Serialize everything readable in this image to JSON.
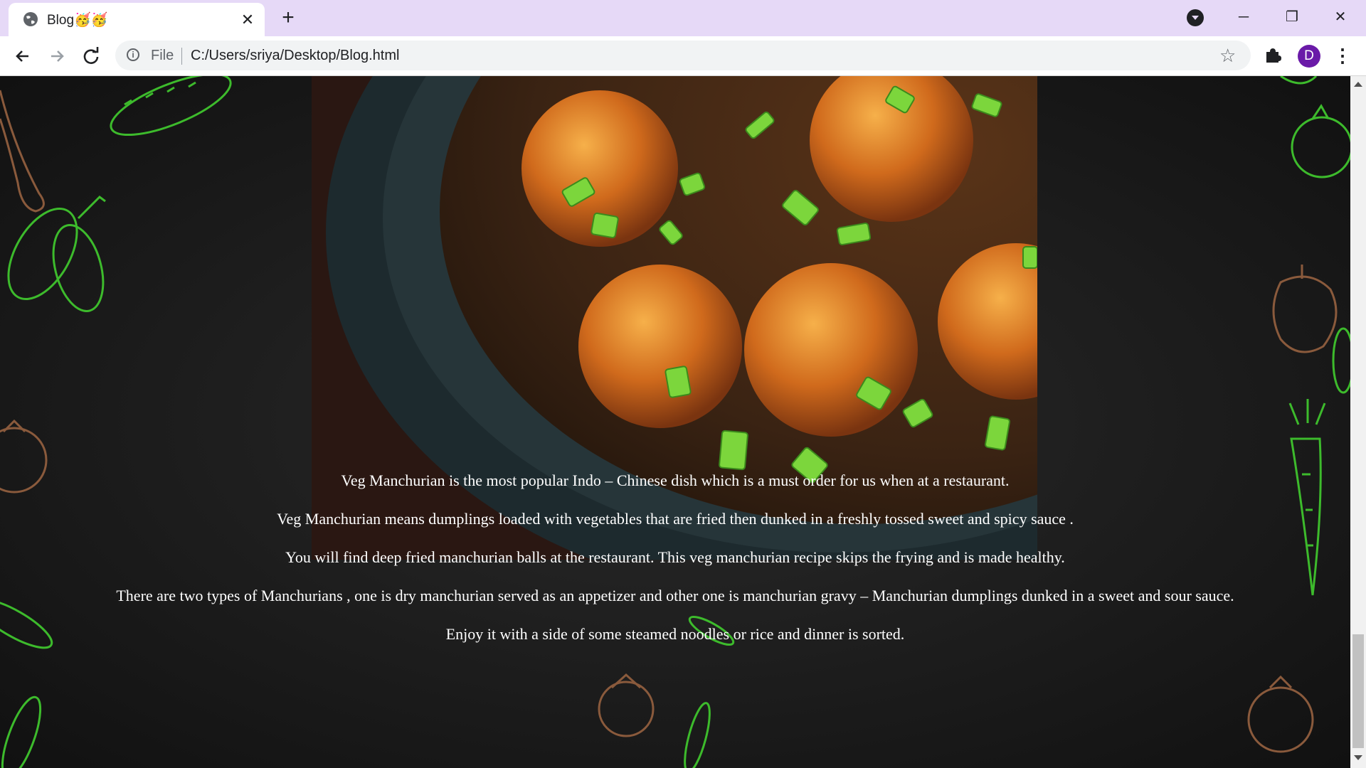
{
  "browser": {
    "tab_title": "Blog🥳🥳",
    "new_tab_symbol": "+",
    "close_symbol": "✕",
    "url_scheme": "File",
    "url": "C:/Users/sriya/Desktop/Blog.html",
    "profile_initial": "D",
    "window_controls": {
      "minimize": "─",
      "restore": "❐",
      "close": "✕"
    },
    "icons": [
      "globe-icon",
      "back-arrow-icon",
      "forward-arrow-icon",
      "reload-icon",
      "info-icon",
      "star-icon",
      "puzzle-icon",
      "more-vert-icon"
    ]
  },
  "content": {
    "image_subject": "veg manchurian dumplings in gravy",
    "paragraphs": [
      "Veg Manchurian is the most popular Indo – Chinese dish which is a must order for us when at a restaurant.",
      "Veg Manchurian means dumplings loaded with vegetables that are fried then dunked in a freshly tossed sweet and spicy sauce .",
      "You will find deep fried manchurian balls at the restaurant. This veg manchurian recipe skips the frying and is made healthy.",
      "There are two types of Manchurians , one is dry manchurian served as an appetizer and other one is manchurian gravy – Manchurian dumplings dunked in a sweet and sour sauce.",
      "Enjoy it with a side of some steamed noodles or rice and dinner is sorted."
    ],
    "colors": {
      "text": "#ffffff",
      "background": "#151515",
      "deco_green": "#3dbb2c",
      "deco_brown": "#8a5a3c"
    }
  }
}
